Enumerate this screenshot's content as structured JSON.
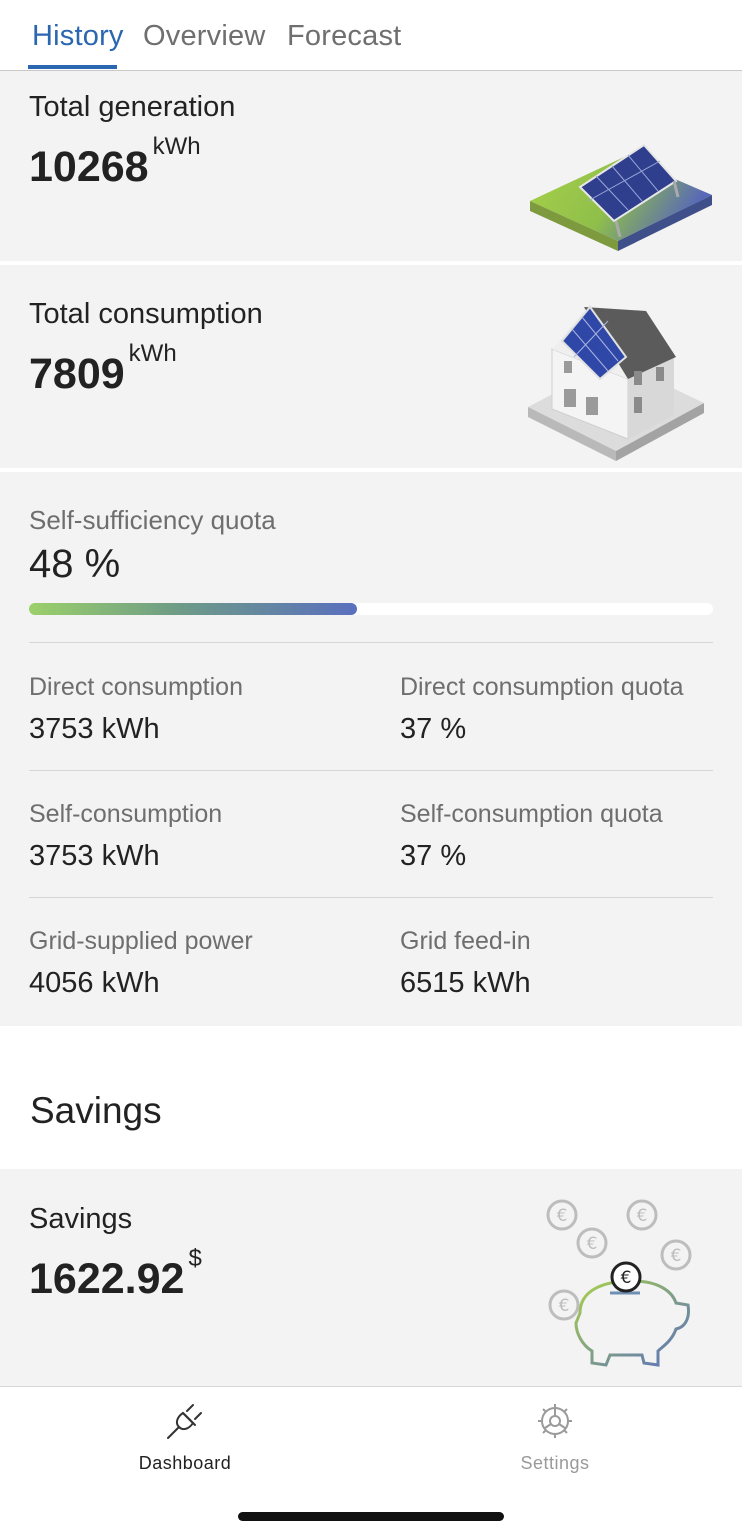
{
  "tabs": [
    {
      "label": "History"
    },
    {
      "label": "Overview"
    },
    {
      "label": "Forecast"
    }
  ],
  "generation": {
    "title": "Total generation",
    "value": "10268",
    "unit": "kWh",
    "illustration": "solar-panel-icon"
  },
  "consumption": {
    "title": "Total consumption",
    "value": "7809",
    "unit": "kWh",
    "illustration": "house-icon"
  },
  "self_sufficiency": {
    "label": "Self-sufficiency quota",
    "value": "48 %",
    "progress_fraction": 0.48
  },
  "stats": [
    {
      "label": "Direct consumption",
      "value": "3753 kWh"
    },
    {
      "label": "Direct consumption quota",
      "value": "37 %"
    },
    {
      "label": "Self-consumption",
      "value": "3753 kWh"
    },
    {
      "label": "Self-consumption quota",
      "value": "37 %"
    },
    {
      "label": "Grid-supplied power",
      "value": "4056 kWh"
    },
    {
      "label": "Grid feed-in",
      "value": "6515 kWh"
    }
  ],
  "savings_section": {
    "header": "Savings"
  },
  "savings": {
    "title": "Savings",
    "value": "1622.92",
    "unit": "$",
    "illustration": "piggy-bank-icon"
  },
  "nav": [
    {
      "label": "Dashboard",
      "icon": "plug-icon",
      "active": true
    },
    {
      "label": "Settings",
      "icon": "gear-icon",
      "active": false
    }
  ],
  "colors": {
    "accent": "#2b66b0",
    "card_bg": "#f3f3f3",
    "progress_start": "#9bd06a",
    "progress_end": "#5a6fbf"
  }
}
